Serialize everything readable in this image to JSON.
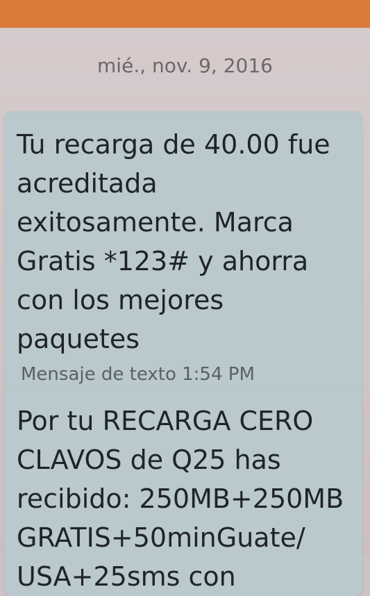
{
  "date_header": "mié., nov. 9, 2016",
  "messages": [
    {
      "text": "Tu recarga de 40.00 fue acreditada exitosamente. Marca Gratis *123# y ahorra con los mejores paquetes",
      "meta": "Mensaje de texto 1:54 PM"
    },
    {
      "text": "Por tu RECARGA CERO CLAVOS de Q25 has recibido: 250MB+250MB GRATIS+50minGuate/ USA+25sms con",
      "meta": ""
    }
  ],
  "colors": {
    "top_bar": "#d97a3a",
    "screen_background": "#d6cbcc",
    "bubble_background": "#b9c9ce",
    "date_text": "#6e6669"
  }
}
